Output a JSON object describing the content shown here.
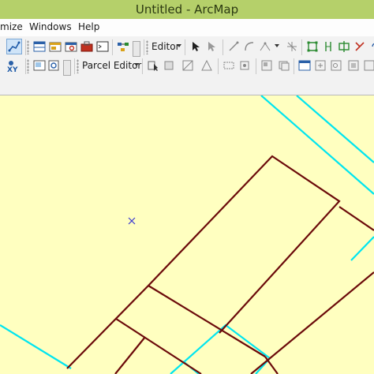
{
  "window": {
    "title": "Untitled - ArcMap"
  },
  "menubar": {
    "items": [
      "mize",
      "Windows",
      "Help"
    ]
  },
  "toolbar": {
    "editor_label": "Editor",
    "parcel_editor_label": "Parcel Editor",
    "xy_label": "XY"
  },
  "colors": {
    "titlebar": "#b5d06a",
    "map_background": "#ffffc0",
    "parcel_lines": "#6b0a0a",
    "cyan_lines": "#00e5f0",
    "marker": "#3a3ad0"
  }
}
